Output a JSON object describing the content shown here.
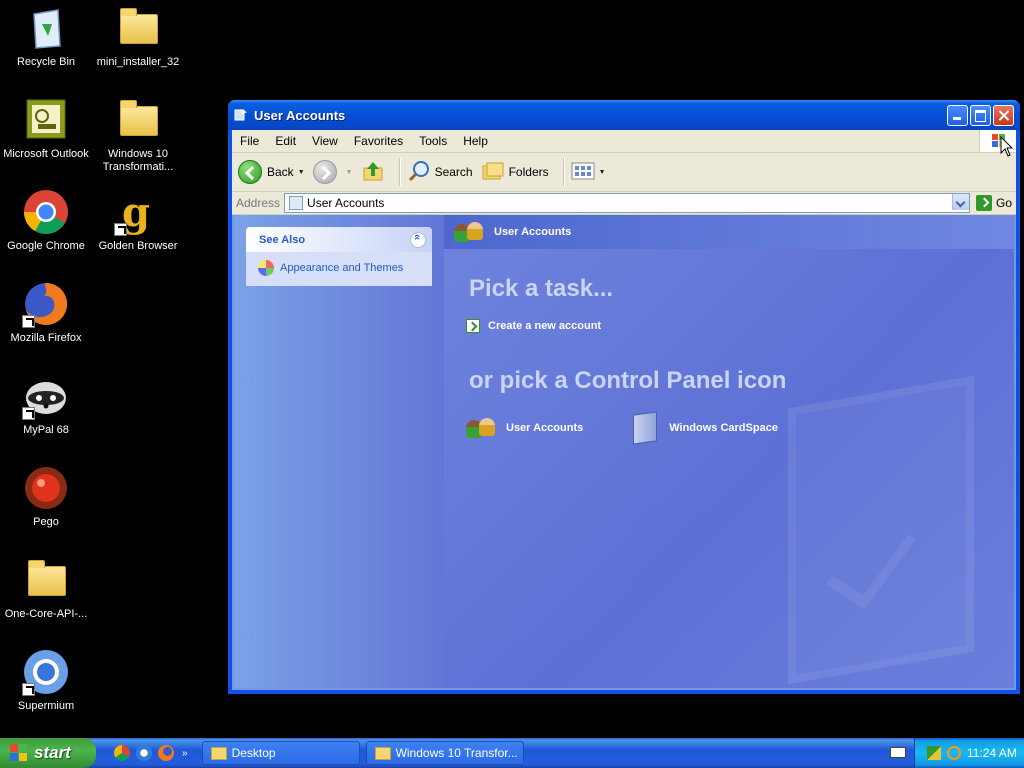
{
  "desktop": {
    "icons": [
      {
        "label": "Recycle Bin",
        "icon": "recycle-bin-icon"
      },
      {
        "label": "mini_installer_32",
        "icon": "folder-icon"
      },
      {
        "label": "Microsoft Outlook",
        "icon": "outlook-icon"
      },
      {
        "label": "Windows 10 Transformati...",
        "icon": "folder-icon"
      },
      {
        "label": "Google Chrome",
        "icon": "chrome-icon"
      },
      {
        "label": "Golden Browser",
        "icon": "golden-browser-icon"
      },
      {
        "label": "Mozilla Firefox",
        "icon": "firefox-icon"
      },
      {
        "label": "MyPal 68",
        "icon": "mypal-icon"
      },
      {
        "label": "Pego",
        "icon": "pego-icon"
      },
      {
        "label": "One-Core-API-...",
        "icon": "folder-icon"
      },
      {
        "label": "Supermium",
        "icon": "supermium-icon"
      }
    ]
  },
  "window": {
    "title": "User Accounts",
    "menu": [
      "File",
      "Edit",
      "View",
      "Favorites",
      "Tools",
      "Help"
    ],
    "toolbar": {
      "back": "Back",
      "search": "Search",
      "folders": "Folders"
    },
    "address": {
      "label": "Address",
      "value": "User Accounts",
      "go": "Go"
    },
    "see_also": {
      "title": "See Also",
      "items": [
        "Appearance and Themes"
      ]
    },
    "main": {
      "header": "User Accounts",
      "pick_task": "Pick a task...",
      "tasks": [
        "Create a new account"
      ],
      "pick_icon": "or pick a Control Panel icon",
      "icons": [
        "User Accounts",
        "Windows CardSpace"
      ]
    }
  },
  "taskbar": {
    "start": "start",
    "buttons": [
      "Desktop",
      "Windows 10 Transfor..."
    ],
    "clock": "11:24 AM"
  },
  "colors": {
    "titlebar": "#0650d6",
    "taskbar": "#245ddb",
    "start": "#4cb54c",
    "tray": "#18b9ef",
    "mainpane": "#5d70d5"
  }
}
